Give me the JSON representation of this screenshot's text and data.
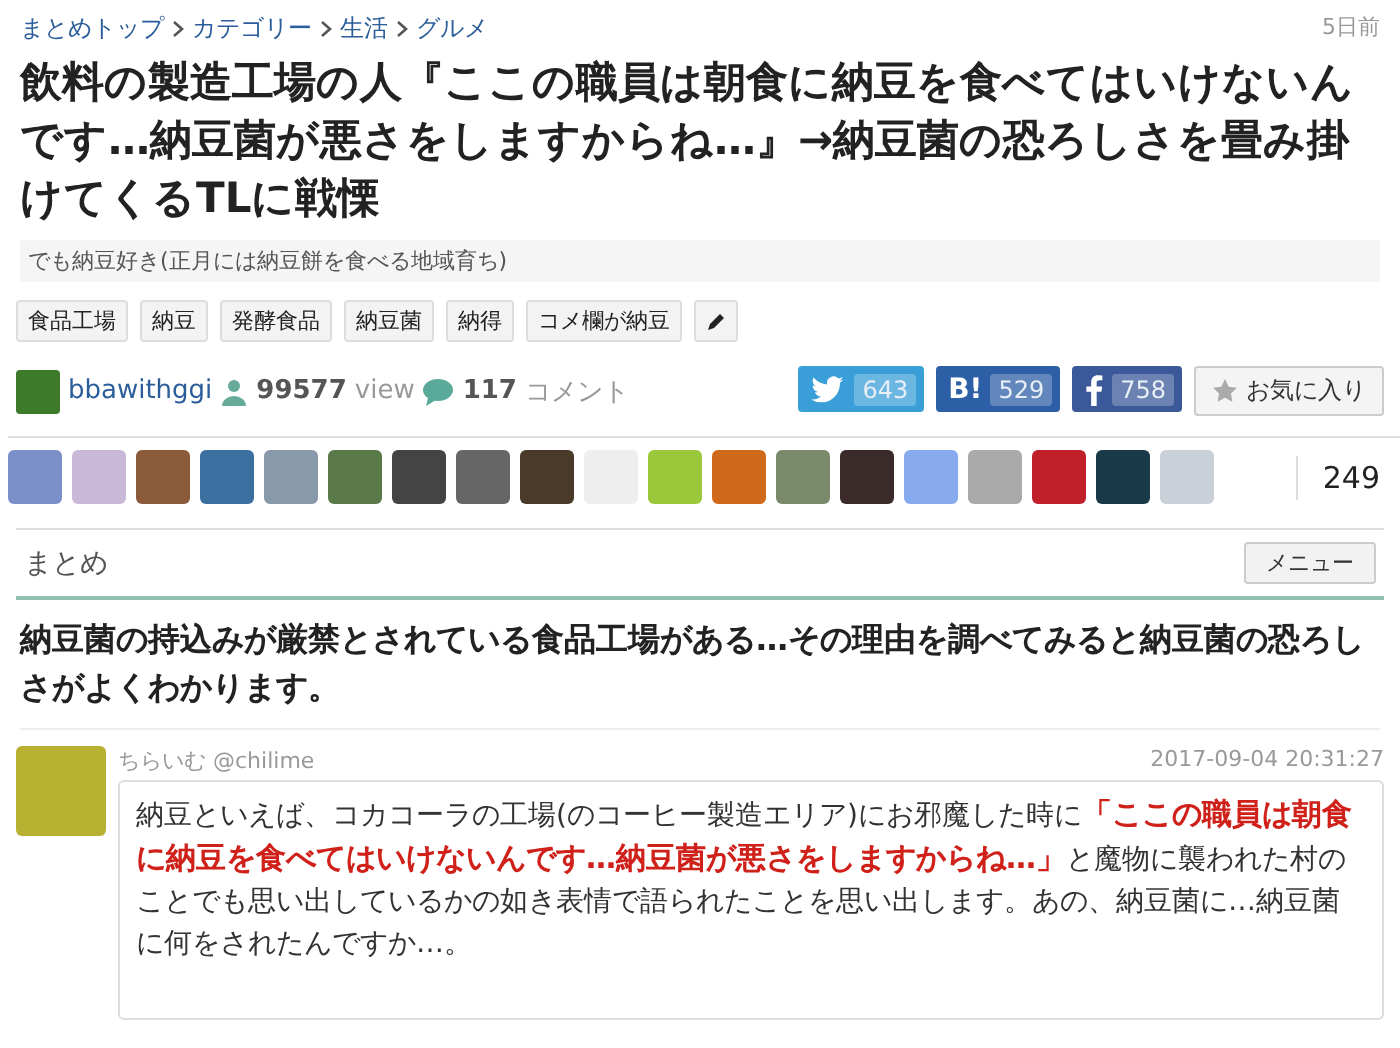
{
  "breadcrumb": [
    {
      "label": "まとめトップ"
    },
    {
      "label": "カテゴリー"
    },
    {
      "label": "生活"
    },
    {
      "label": "グルメ"
    }
  ],
  "posted": "5日前",
  "title": "飲料の製造工場の人『ここの職員は朝食に納豆を食べてはいけないんです…納豆菌が悪さをしますからね…』→納豆菌の恐ろしさを畳み掛けてくるTLに戦慄",
  "description": "でも納豆好き(正月には納豆餅を食べる地域育ち)",
  "tags": [
    {
      "label": "食品工場"
    },
    {
      "label": "納豆"
    },
    {
      "label": "発酵食品"
    },
    {
      "label": "納豆菌"
    },
    {
      "label": "納得"
    },
    {
      "label": "コメ欄が納豆"
    }
  ],
  "author": {
    "name": "bbawithggi",
    "views": "99577",
    "views_unit": "view",
    "comments": "117",
    "comments_unit": "コメント"
  },
  "share": [
    {
      "kind": "twitter",
      "count": "643"
    },
    {
      "kind": "hatena",
      "label": "B!",
      "count": "529"
    },
    {
      "kind": "facebook",
      "count": "758"
    }
  ],
  "favorite": {
    "label": "お気に入り"
  },
  "favorited_count": "249",
  "section": {
    "title": "まとめ",
    "menu": "メニュー"
  },
  "lead": "納豆菌の持込みが厳禁とされている食品工場がある…その理由を調べてみると納豆菌の恐ろしさがよくわかります。",
  "tweet": {
    "name": "ちらいむ",
    "handle": "@chilime",
    "time": "2017-09-04 20:31:27",
    "text": "納豆といえば、コカコーラの工場(のコーヒー製造エリア)にお邪魔した時に**「ここの職員は朝食に納豆を食べてはいけないんです…納豆菌が悪さをしますからね…」**と魔物に襲われた村のことでも思い出しているかの如き表情で語られたことを思い出します。あの、納豆菌に…納豆菌に何をされたんですか…。"
  }
}
